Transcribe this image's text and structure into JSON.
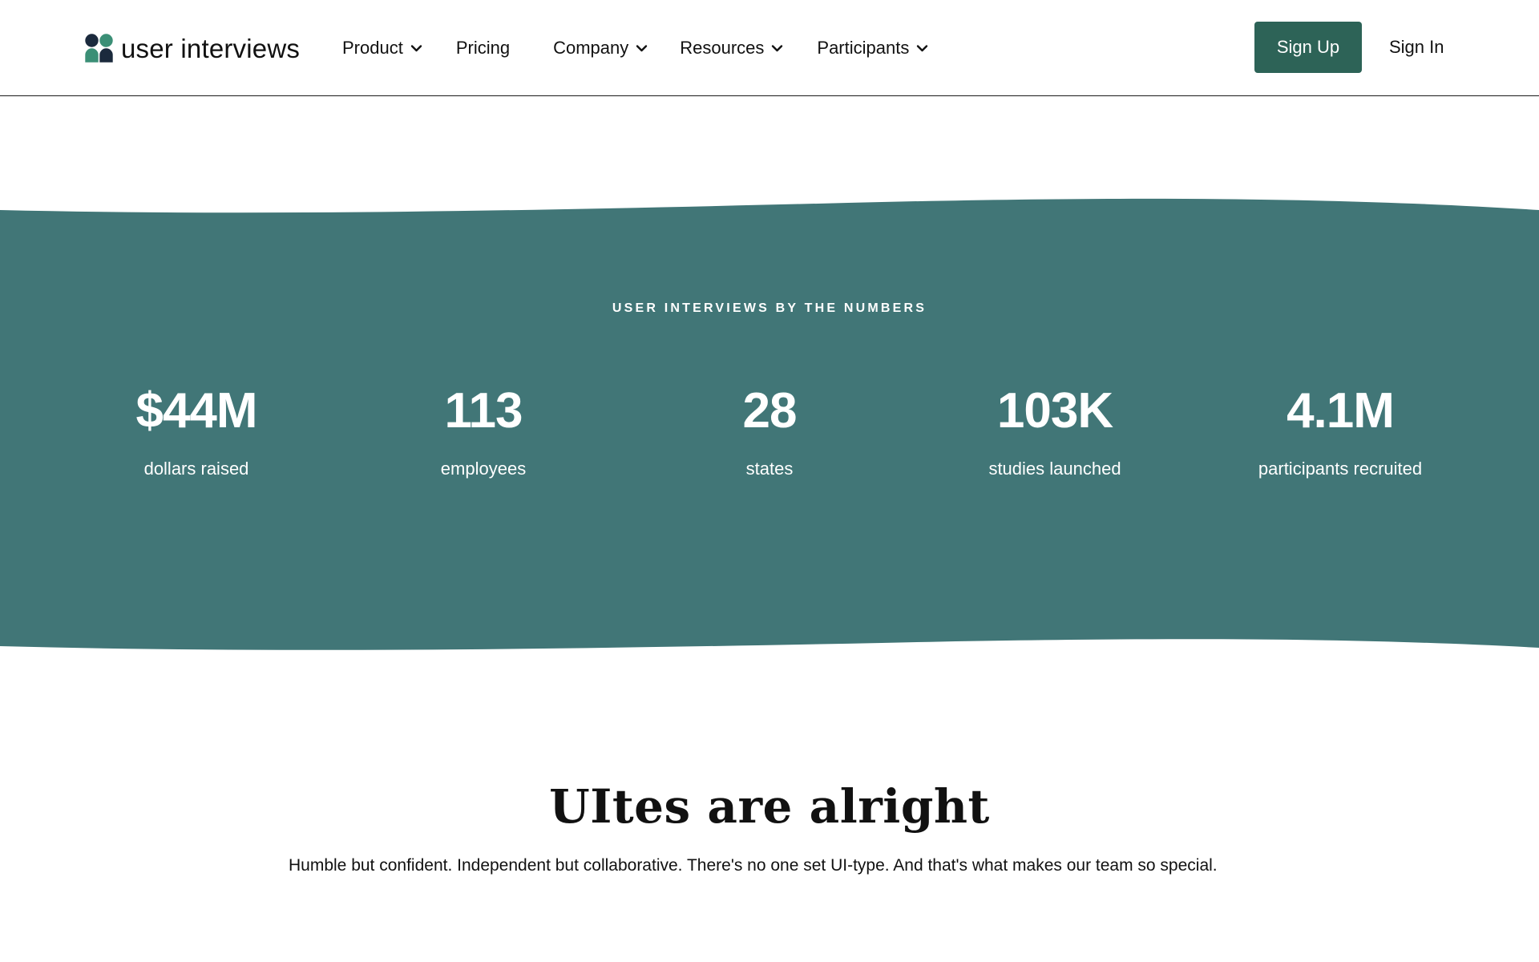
{
  "brand": {
    "name": "user interviews",
    "colors": {
      "primary_button": "#2d6357",
      "band": "#417677",
      "logo_dark": "#1b2a3d",
      "logo_green": "#3b8f76"
    }
  },
  "header": {
    "nav": [
      {
        "label": "Product",
        "has_dropdown": true,
        "icon": "chevron-down-icon"
      },
      {
        "label": "Pricing",
        "has_dropdown": false
      },
      {
        "label": "Company",
        "has_dropdown": true,
        "icon": "chevron-down-icon"
      },
      {
        "label": "Resources",
        "has_dropdown": true,
        "icon": "chevron-down-icon"
      },
      {
        "label": "Participants",
        "has_dropdown": true,
        "icon": "chevron-down-icon"
      }
    ],
    "sign_up_label": "Sign Up",
    "sign_in_label": "Sign In"
  },
  "stats": {
    "eyebrow": "USER INTERVIEWS BY THE NUMBERS",
    "items": [
      {
        "value": "$44M",
        "label": "dollars raised"
      },
      {
        "value": "113",
        "label": "employees"
      },
      {
        "value": "28",
        "label": "states"
      },
      {
        "value": "103K",
        "label": "studies launched"
      },
      {
        "value": "4.1M",
        "label": "participants recruited"
      }
    ]
  },
  "culture": {
    "title": "UItes are alright",
    "body": "Humble but confident. Independent but collaborative. There's no one set UI-type. And that's what makes our team so special."
  }
}
